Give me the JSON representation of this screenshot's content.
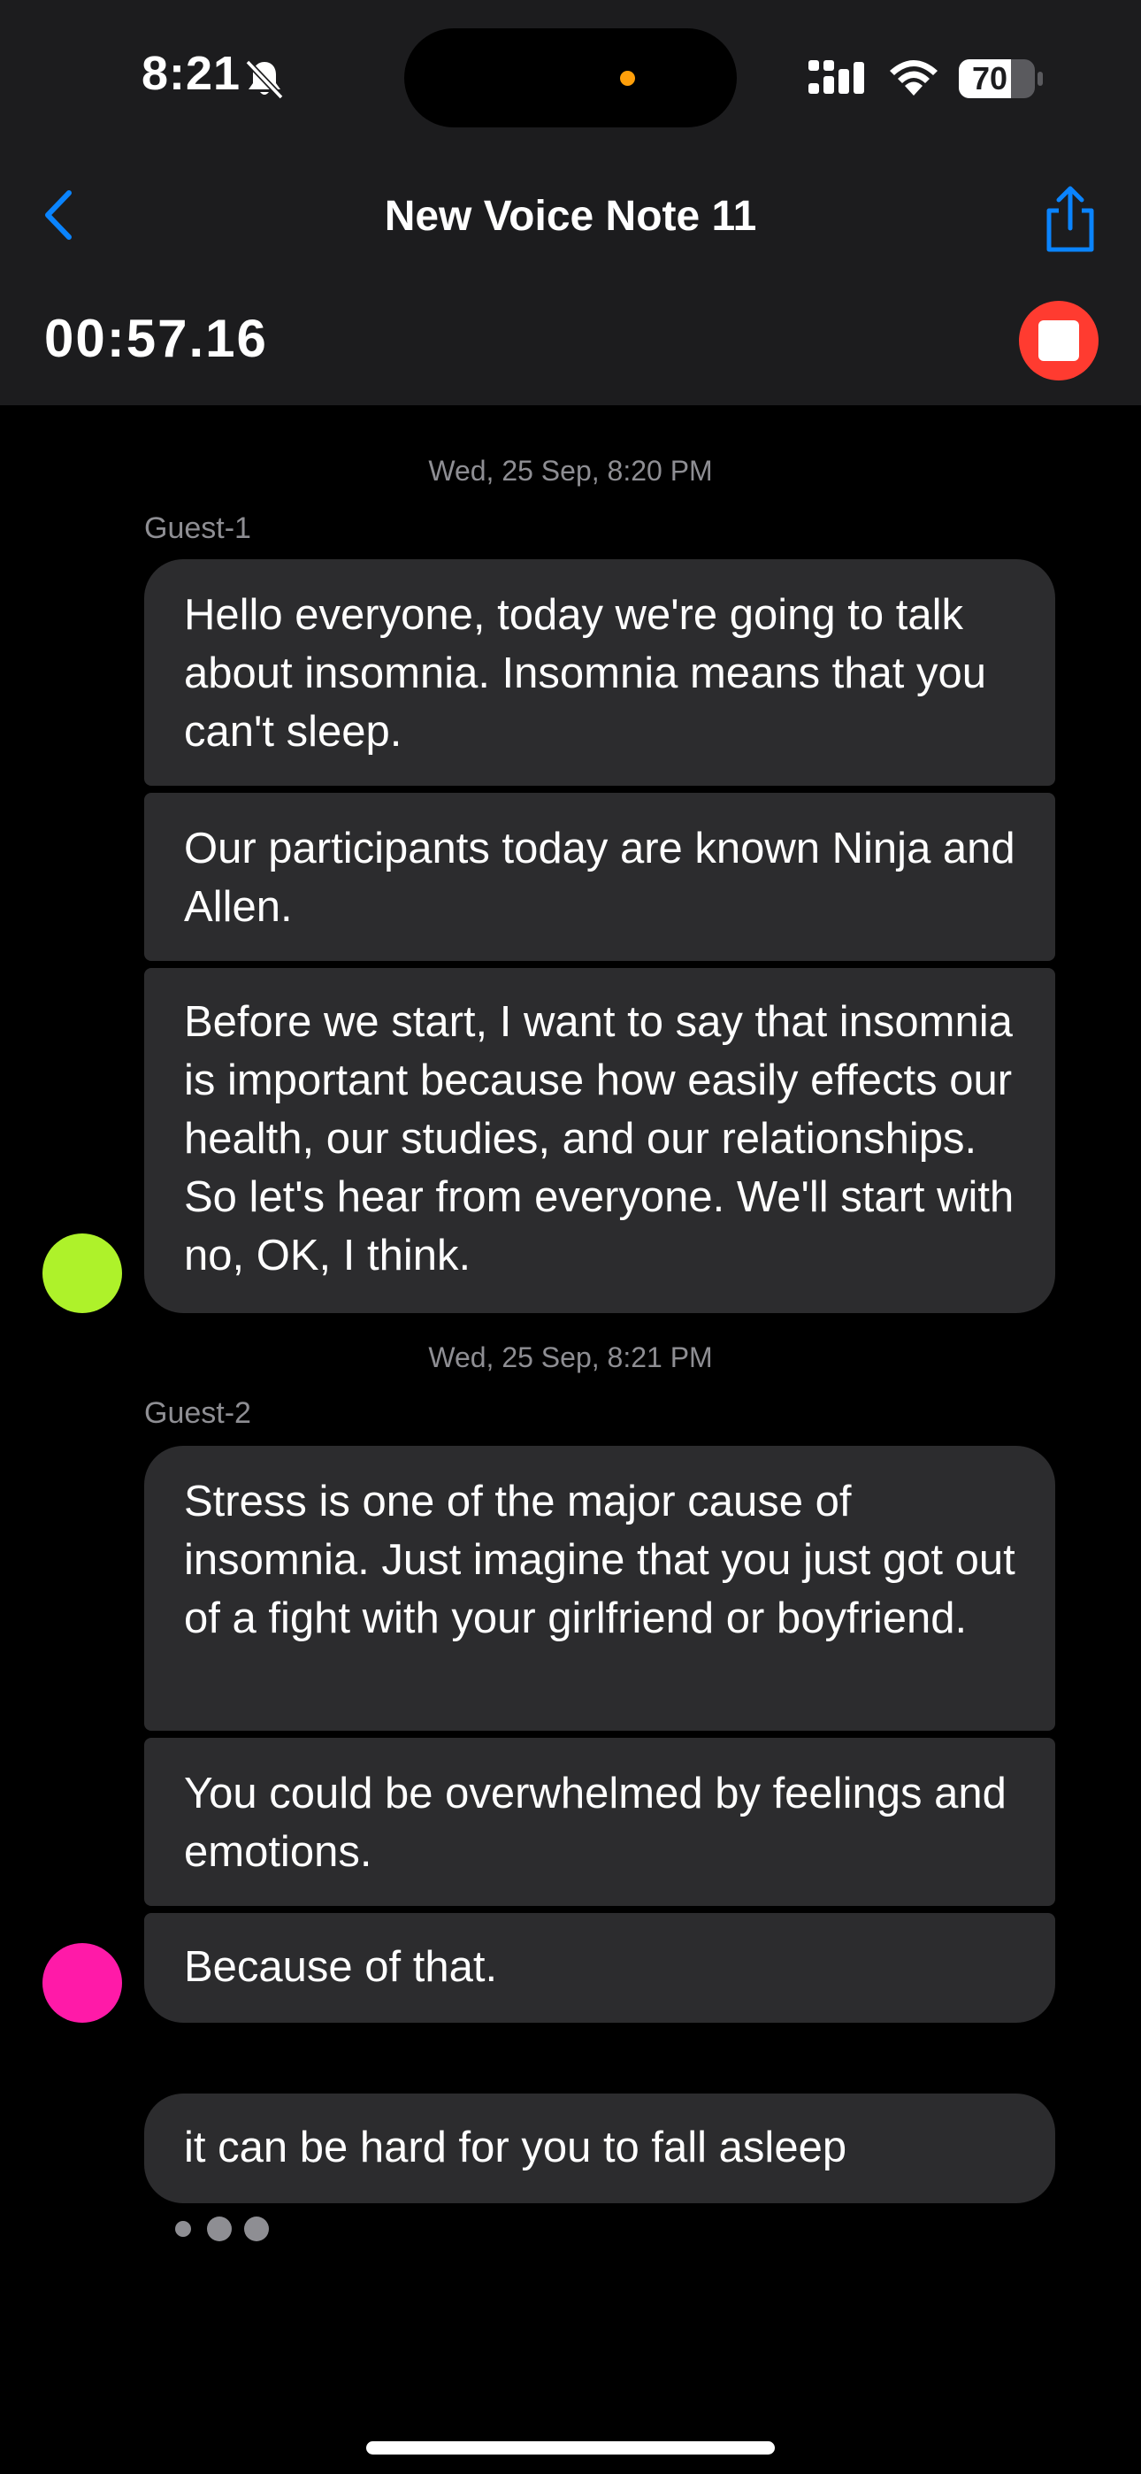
{
  "status_bar": {
    "time": "8:21",
    "battery": "70"
  },
  "nav": {
    "title": "New Voice Note 11"
  },
  "recording": {
    "timer": "00:57.16"
  },
  "colors": {
    "accent": "#0a84ff",
    "stop": "#ff3b30",
    "guest1_avatar": "#aef22a",
    "guest2_avatar": "#ff1aa8",
    "bubble": "#2c2c2e",
    "header": "#1c1c1e"
  },
  "conversation": [
    {
      "timestamp": "Wed, 25 Sep, 8:20 PM",
      "speaker": "Guest-1",
      "messages": [
        "Hello everyone, today we're going to talk about insomnia. Insomnia means that you can't sleep.",
        "Our participants today are known Ninja and Allen.",
        "Before we start, I want to say that insomnia is important because how easily effects our health, our studies, and our relationships. So let's hear from everyone. We'll start with no, OK, I think."
      ]
    },
    {
      "timestamp": "Wed, 25 Sep, 8:21 PM",
      "speaker": "Guest-2",
      "messages": [
        "Stress is one of the major cause of insomnia. Just imagine that you just got out of a fight with your girlfriend or boyfriend.",
        "You could be overwhelmed by feelings and emotions.",
        "Because of that."
      ]
    }
  ],
  "live_transcript": "it can be hard for you to fall asleep",
  "icons": [
    "bell-slash-icon",
    "signal-icon",
    "wifi-icon",
    "battery-icon",
    "chevron-left-icon",
    "share-icon",
    "stop-icon"
  ]
}
